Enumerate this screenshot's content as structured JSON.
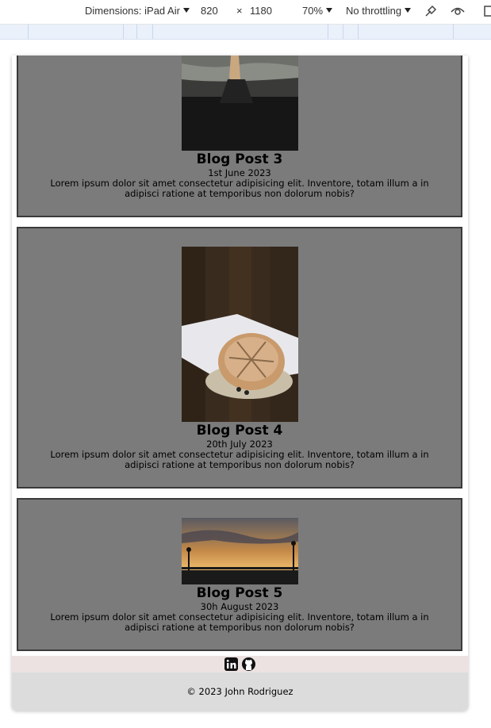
{
  "devtools": {
    "dimensions_label": "Dimensions: iPad Air",
    "width": "820",
    "times": "×",
    "height": "1180",
    "zoom": "70%",
    "throttling": "No throttling"
  },
  "posts": [
    {
      "title": "Blog Post 3",
      "date": "1st June 2023",
      "excerpt": "Lorem ipsum dolor sit amet consectetur adipisicing elit. Inventore, totam illum a in adipisci ratione at temporibus non dolorum nobis?"
    },
    {
      "title": "Blog Post 4",
      "date": "20th July 2023",
      "excerpt": "Lorem ipsum dolor sit amet consectetur adipisicing elit. Inventore, totam illum a in adipisci ratione at temporibus non dolorum nobis?"
    },
    {
      "title": "Blog Post 5",
      "date": "30h August 2023",
      "excerpt": "Lorem ipsum dolor sit amet consectetur adipisicing elit. Inventore, totam illum a in adipisci ratione at temporibus non dolorum nobis?"
    }
  ],
  "social": {
    "linkedin_icon": "linkedin-icon",
    "github_icon": "github-icon"
  },
  "footer": {
    "copyright": "© 2023 John Rodriguez"
  },
  "colors": {
    "card_bg": "#7b7b7b",
    "card_border": "#3a3a3a",
    "social_bar": "#ece2e2",
    "footer_bg": "#dcdcdc"
  }
}
